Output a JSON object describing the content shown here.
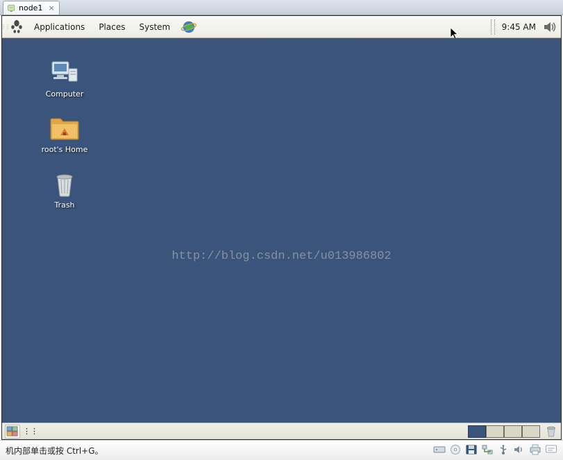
{
  "host": {
    "tab_label": "node1",
    "status_hint": "机内部单击或按 Ctrl+G。"
  },
  "panel": {
    "menus": {
      "applications": "Applications",
      "places": "Places",
      "system": "System"
    },
    "clock": "9:45 AM"
  },
  "desktop_icons": {
    "computer": "Computer",
    "home": "root's Home",
    "trash": "Trash"
  },
  "watermark": "http://blog.csdn.net/u013986802"
}
